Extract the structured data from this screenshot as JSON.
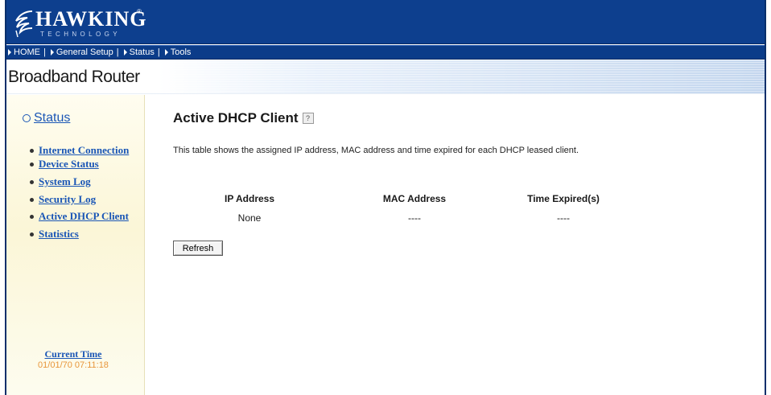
{
  "brand": {
    "name": "HAWKING",
    "registered": "®",
    "subtitle": "TECHNOLOGY"
  },
  "nav": {
    "items": [
      {
        "label": "HOME"
      },
      {
        "label": "General Setup"
      },
      {
        "label": "Status"
      },
      {
        "label": "Tools"
      }
    ]
  },
  "page": {
    "router_title": "Broadband Router"
  },
  "sidebar": {
    "section": "Status",
    "items": [
      {
        "label": "Internet Connection"
      },
      {
        "label": "Device Status"
      },
      {
        "label": "System Log"
      },
      {
        "label": "Security Log"
      },
      {
        "label": "Active DHCP Client"
      },
      {
        "label": "Statistics"
      }
    ],
    "current_time_label": "Current Time",
    "current_time_value": "01/01/70 07:11:18"
  },
  "main": {
    "title": "Active DHCP Client",
    "help_icon": "help-icon",
    "description": "This table shows the assigned IP address, MAC address and time expired for each DHCP leased client.",
    "table": {
      "headers": [
        "IP Address",
        "MAC Address",
        "Time Expired(s)"
      ],
      "rows": [
        [
          "None",
          "----",
          "----"
        ]
      ]
    },
    "refresh_label": "Refresh"
  },
  "colors": {
    "header_bg": "#0d3f8e",
    "link": "#1a56b6",
    "time_value": "#e8963a",
    "sidebar_bg": "#fbf6d7"
  }
}
